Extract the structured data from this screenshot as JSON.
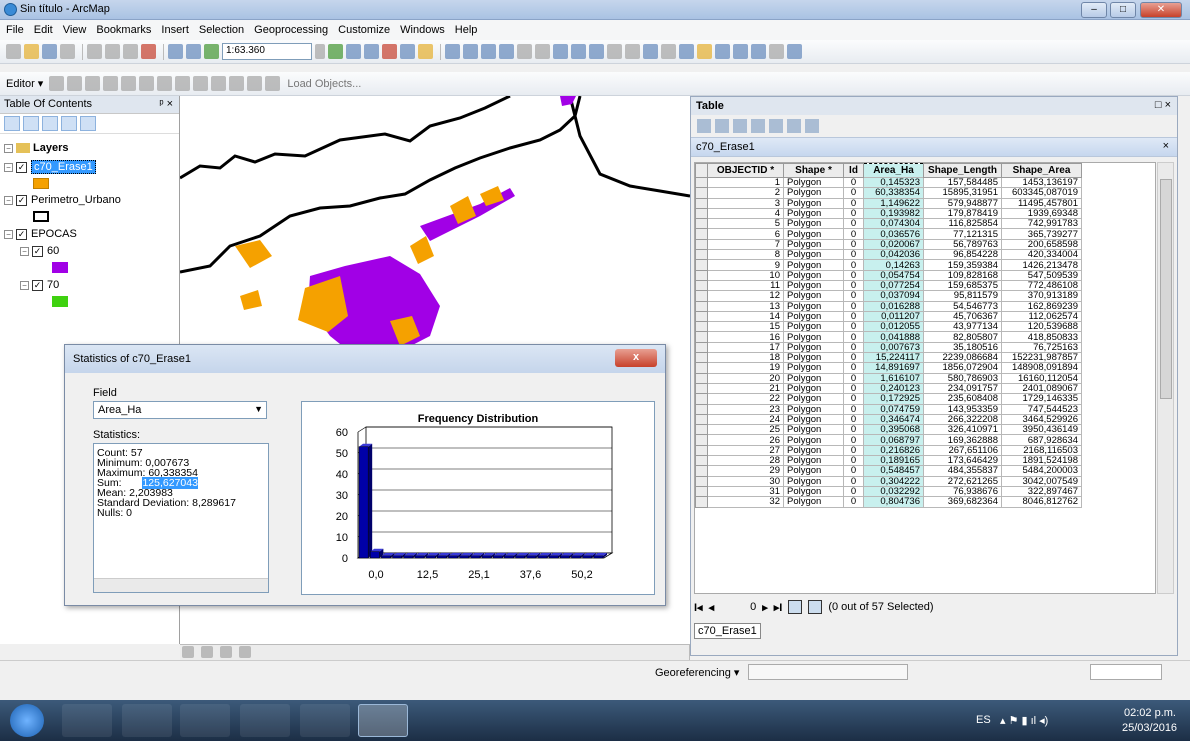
{
  "window": {
    "title": "Sin título - ArcMap"
  },
  "menu": [
    "File",
    "Edit",
    "View",
    "Bookmarks",
    "Insert",
    "Selection",
    "Geoprocessing",
    "Customize",
    "Windows",
    "Help"
  ],
  "toolbar": {
    "scale": "1:63.360",
    "editor_label": "Editor ▾",
    "load_objects": "Load Objects..."
  },
  "toc": {
    "title": "Table Of Contents",
    "pin": "ᵖ ×",
    "layers_label": "Layers",
    "items": [
      {
        "name": "c70_Erase1",
        "color": "#f5a100"
      },
      {
        "name": "Perimetro_Urbano",
        "color": "#ffffff"
      },
      {
        "name": "EPOCAS"
      },
      {
        "name": "60",
        "color": "#a100e6"
      },
      {
        "name": "70",
        "color": "#3fd10f"
      }
    ]
  },
  "table": {
    "title": "Table",
    "tab": "c70_Erase1",
    "selected": "(0 out of 57 Selected)",
    "nav_record": "0",
    "columns": [
      "OBJECTID *",
      "Shape *",
      "Id",
      "Area_Ha",
      "Shape_Length",
      "Shape_Area"
    ],
    "rows": [
      [
        "1",
        "Polygon",
        "0",
        "0,145323",
        "157,584485",
        "1453,136197"
      ],
      [
        "2",
        "Polygon",
        "0",
        "60,338354",
        "15895,31951",
        "603345,087019"
      ],
      [
        "3",
        "Polygon",
        "0",
        "1,149622",
        "579,948877",
        "11495,457801"
      ],
      [
        "4",
        "Polygon",
        "0",
        "0,193982",
        "179,878419",
        "1939,69348"
      ],
      [
        "5",
        "Polygon",
        "0",
        "0,074304",
        "116,825854",
        "742,991783"
      ],
      [
        "6",
        "Polygon",
        "0",
        "0,036576",
        "77,121315",
        "365,739277"
      ],
      [
        "7",
        "Polygon",
        "0",
        "0,020067",
        "56,789763",
        "200,658598"
      ],
      [
        "8",
        "Polygon",
        "0",
        "0,042036",
        "96,854228",
        "420,334004"
      ],
      [
        "9",
        "Polygon",
        "0",
        "0,14263",
        "159,359384",
        "1426,213478"
      ],
      [
        "10",
        "Polygon",
        "0",
        "0,054754",
        "109,828168",
        "547,509539"
      ],
      [
        "11",
        "Polygon",
        "0",
        "0,077254",
        "159,685375",
        "772,486108"
      ],
      [
        "12",
        "Polygon",
        "0",
        "0,037094",
        "95,811579",
        "370,913189"
      ],
      [
        "13",
        "Polygon",
        "0",
        "0,016288",
        "54,546773",
        "162,869239"
      ],
      [
        "14",
        "Polygon",
        "0",
        "0,011207",
        "45,706367",
        "112,062574"
      ],
      [
        "15",
        "Polygon",
        "0",
        "0,012055",
        "43,977134",
        "120,539688"
      ],
      [
        "16",
        "Polygon",
        "0",
        "0,041888",
        "82,805807",
        "418,850833"
      ],
      [
        "17",
        "Polygon",
        "0",
        "0,007673",
        "35,180516",
        "76,725163"
      ],
      [
        "18",
        "Polygon",
        "0",
        "15,224117",
        "2239,086684",
        "152231,987857"
      ],
      [
        "19",
        "Polygon",
        "0",
        "14,891697",
        "1856,072904",
        "148908,091894"
      ],
      [
        "20",
        "Polygon",
        "0",
        "1,616107",
        "580,786903",
        "16160,112054"
      ],
      [
        "21",
        "Polygon",
        "0",
        "0,240123",
        "234,091757",
        "2401,089067"
      ],
      [
        "22",
        "Polygon",
        "0",
        "0,172925",
        "235,608408",
        "1729,146335"
      ],
      [
        "23",
        "Polygon",
        "0",
        "0,074759",
        "143,953359",
        "747,544523"
      ],
      [
        "24",
        "Polygon",
        "0",
        "0,346474",
        "266,322208",
        "3464,529926"
      ],
      [
        "25",
        "Polygon",
        "0",
        "0,395068",
        "326,410971",
        "3950,436149"
      ],
      [
        "26",
        "Polygon",
        "0",
        "0,068797",
        "169,362888",
        "687,928634"
      ],
      [
        "27",
        "Polygon",
        "0",
        "0,216826",
        "267,651106",
        "2168,116503"
      ],
      [
        "28",
        "Polygon",
        "0",
        "0,189165",
        "173,646429",
        "1891,524198"
      ],
      [
        "29",
        "Polygon",
        "0",
        "0,548457",
        "484,355837",
        "5484,200003"
      ],
      [
        "30",
        "Polygon",
        "0",
        "0,304222",
        "272,621265",
        "3042,007549"
      ],
      [
        "31",
        "Polygon",
        "0",
        "0,032292",
        "76,938676",
        "322,897467"
      ],
      [
        "32",
        "Polygon",
        "0",
        "0,804736",
        "369,682364",
        "8046,812762"
      ]
    ]
  },
  "stats": {
    "title": "Statistics of c70_Erase1",
    "close": "x",
    "field_label": "Field",
    "field_value": "Area_Ha",
    "statistics_label": "Statistics:",
    "count": "Count:   57",
    "min": "Minimum: 0,007673",
    "max": "Maximum: 60,338354",
    "sum_label": "Sum:",
    "sum_value": "125,627043",
    "mean": "Mean:    2,203983",
    "std": "Standard Deviation: 8,289617",
    "nulls": "Nulls:   0"
  },
  "chart_data": {
    "type": "bar",
    "title": "Frequency Distribution",
    "x_tick_labels": [
      "0,0",
      "12,5",
      "25,1",
      "37,6",
      "50,2"
    ],
    "values": [
      53,
      3,
      1,
      1,
      1,
      1,
      1,
      1,
      1,
      1,
      1,
      1,
      1,
      1,
      1,
      1,
      1,
      1,
      1,
      1,
      1,
      1
    ],
    "ylim": [
      0,
      60
    ],
    "yticks": [
      0,
      10,
      20,
      30,
      40,
      50,
      60
    ],
    "color": "#0000a8"
  },
  "statusbar": {
    "georef": "Georeferencing ▾"
  },
  "taskbar": {
    "lang": "ES",
    "time": "02:02 p.m.",
    "date": "25/03/2016"
  }
}
